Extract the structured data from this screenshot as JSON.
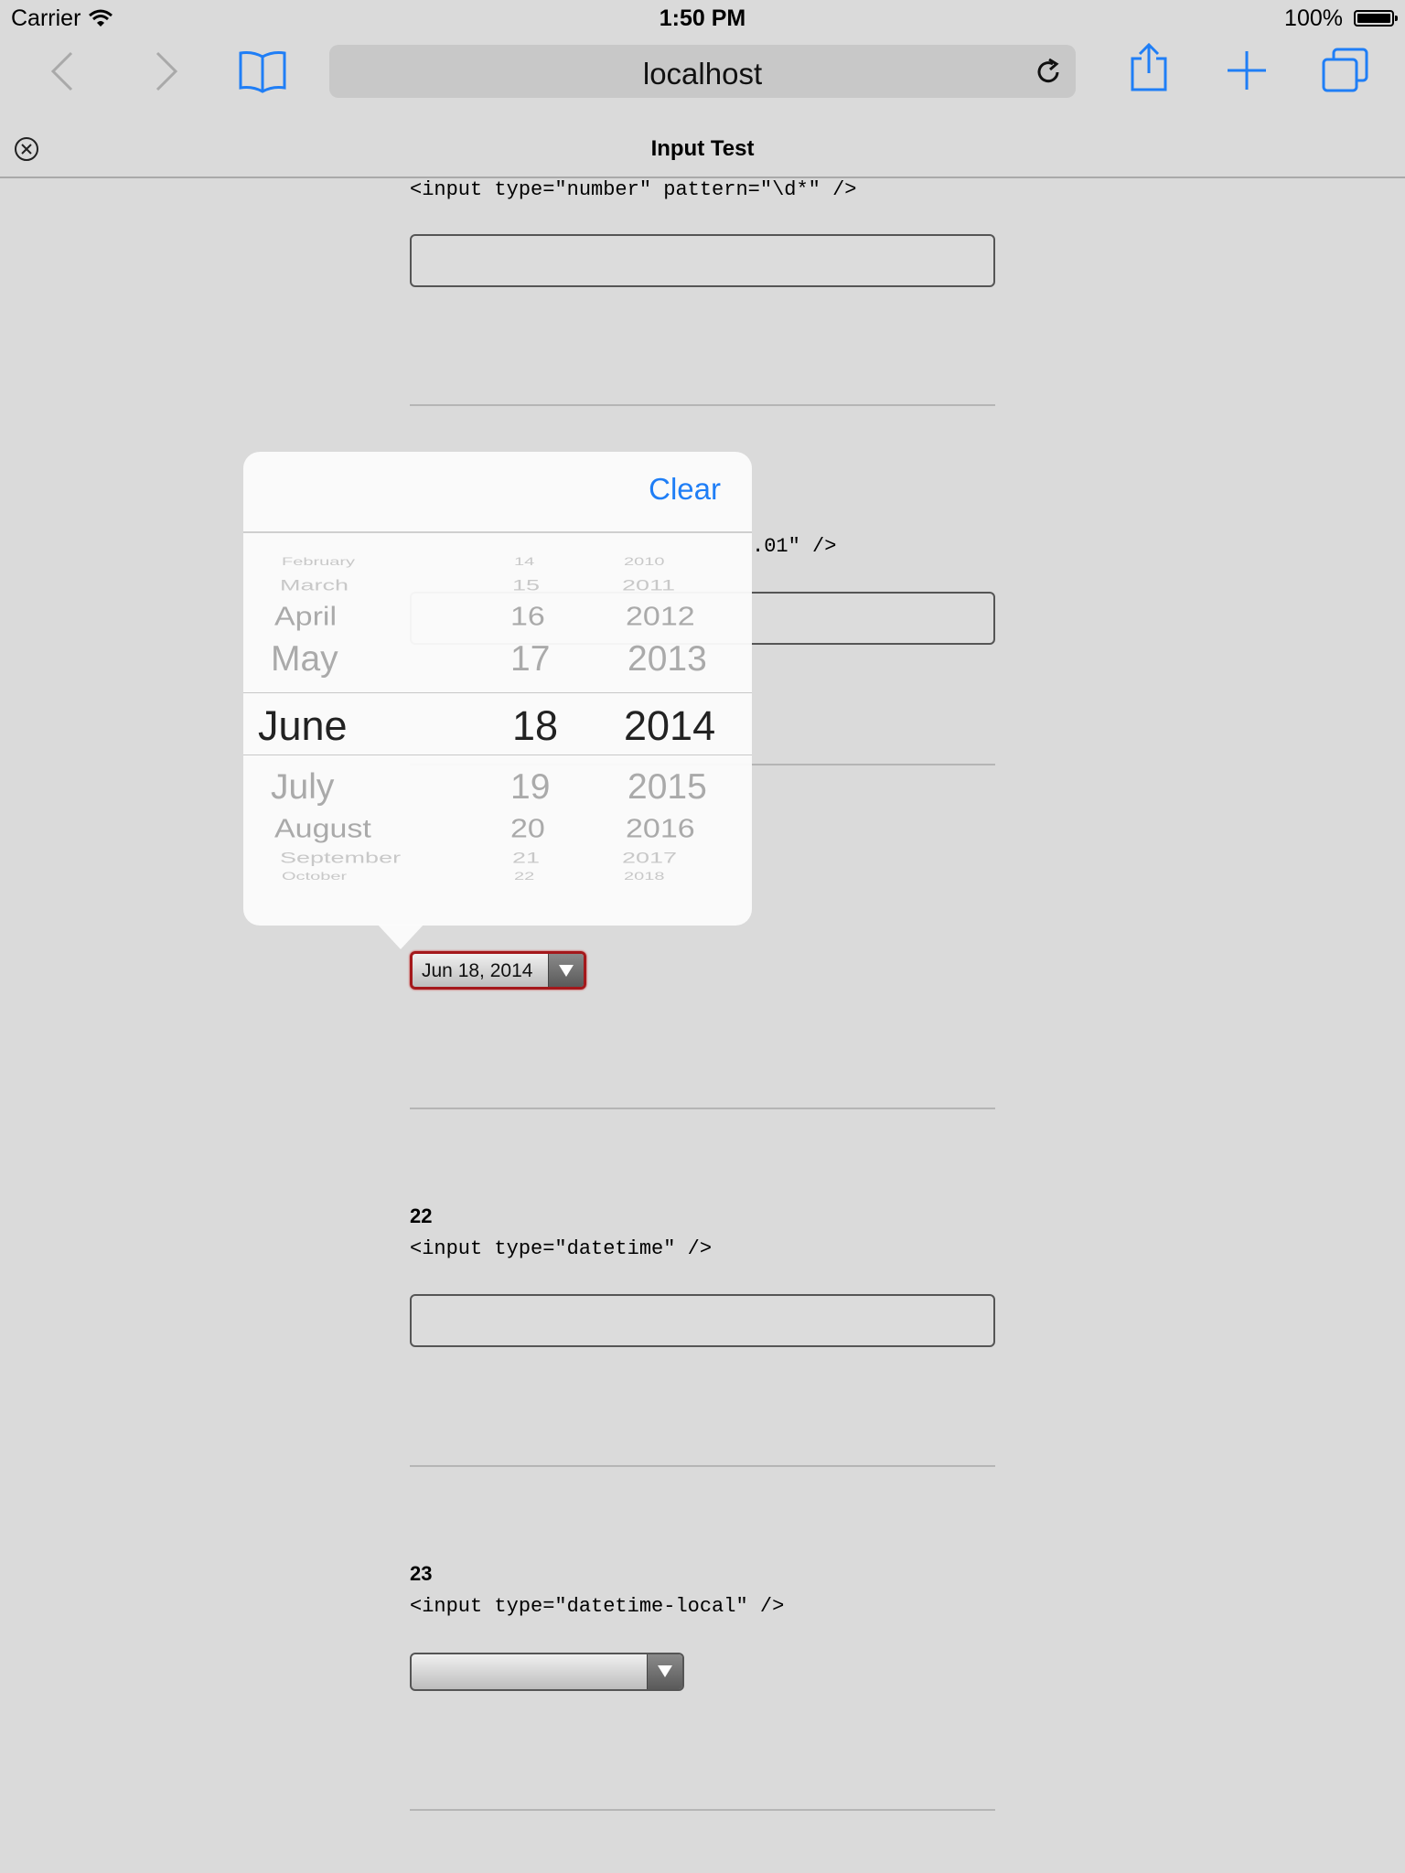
{
  "status_bar": {
    "carrier": "Carrier",
    "time": "1:50 PM",
    "battery": "100%"
  },
  "toolbar": {
    "url": "localhost",
    "icons": [
      "back-icon",
      "forward-icon",
      "bookmarks-icon",
      "reload-icon",
      "share-icon",
      "new-tab-icon",
      "tabs-icon"
    ]
  },
  "tab": {
    "title": "Input Test"
  },
  "sections": [
    {
      "code": "<input type=\"number\" pattern=\"\\d*\" />"
    },
    {
      "code_visible_tail": ".01\" />"
    },
    {
      "number": "22",
      "code": "<input type=\"datetime\" />"
    },
    {
      "number": "23",
      "code": "<input type=\"datetime-local\" />"
    }
  ],
  "date_field": {
    "value": "Jun 18, 2014"
  },
  "popover": {
    "clear_label": "Clear",
    "months": [
      "February",
      "March",
      "April",
      "May",
      "June",
      "July",
      "August",
      "September",
      "October"
    ],
    "days": [
      "14",
      "15",
      "16",
      "17",
      "18",
      "19",
      "20",
      "21",
      "22"
    ],
    "years": [
      "2010",
      "2011",
      "2012",
      "2013",
      "2014",
      "2015",
      "2016",
      "2017",
      "2018"
    ],
    "selected": {
      "month": "June",
      "day": "18",
      "year": "2014"
    }
  },
  "colors": {
    "accent": "#1f7ef6",
    "focus_border": "#a4181b",
    "page_background": "#dadada"
  }
}
